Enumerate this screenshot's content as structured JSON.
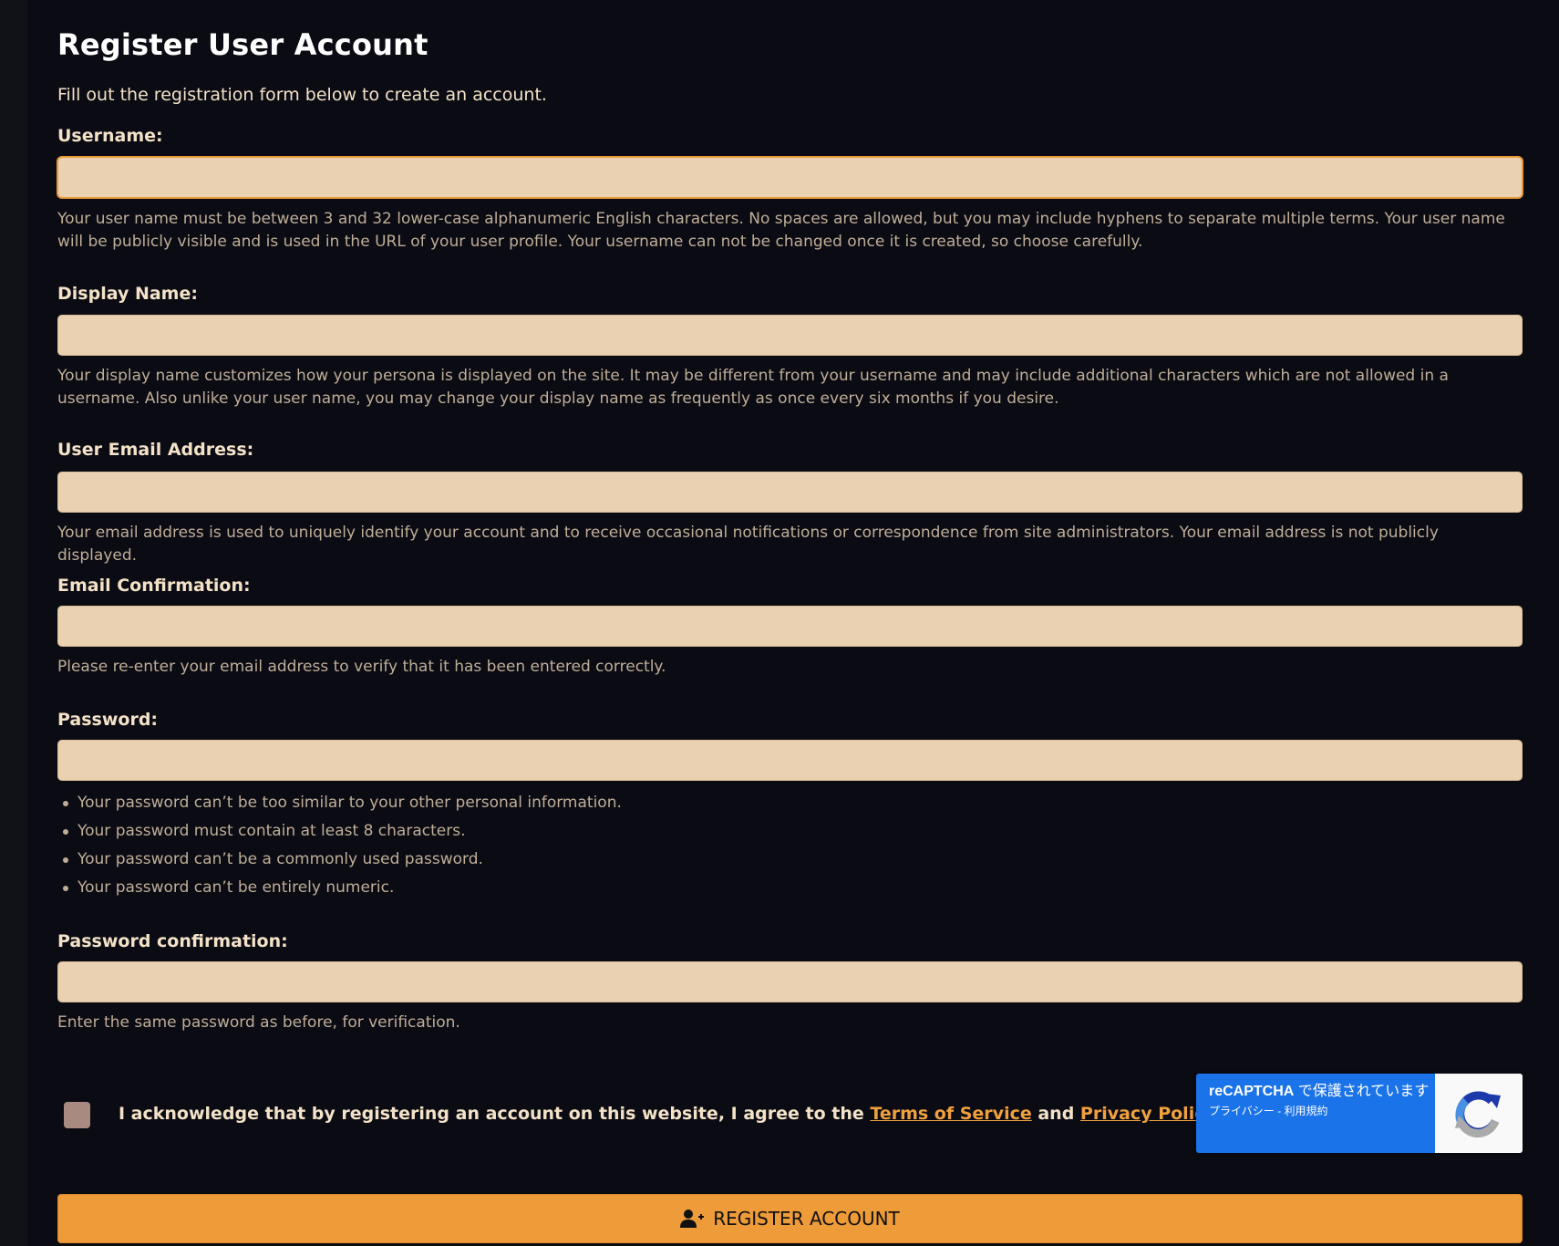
{
  "page": {
    "title": "Register User Account",
    "intro": "Fill out the registration form below to create an account."
  },
  "fields": {
    "username": {
      "label": "Username:",
      "value": "",
      "help": "Your user name must be between 3 and 32 lower-case alphanumeric English characters. No spaces are allowed, but you may include hyphens to separate multiple terms. Your user name will be publicly visible and is used in the URL of your user profile. Your username can not be changed once it is created, so choose carefully."
    },
    "display_name": {
      "label": "Display Name:",
      "value": "",
      "help": "Your display name customizes how your persona is displayed on the site. It may be different from your username and may include additional characters which are not allowed in a username. Also unlike your user name, you may change your display name as frequently as once every six months if you desire."
    },
    "email": {
      "label": "User Email Address:",
      "value": "",
      "help": "Your email address is used to uniquely identify your account and to receive occasional notifications or correspondence from site administrators. Your email address is not publicly displayed."
    },
    "email_confirm": {
      "label": "Email Confirmation:",
      "value": "",
      "help": "Please re-enter your email address to verify that it has been entered correctly."
    },
    "password": {
      "label": "Password:",
      "value": "",
      "rules": [
        "Your password can’t be too similar to your other personal information.",
        "Your password must contain at least 8 characters.",
        "Your password can’t be a commonly used password.",
        "Your password can’t be entirely numeric."
      ]
    },
    "password_confirm": {
      "label": "Password confirmation:",
      "value": "",
      "help": "Enter the same password as before, for verification."
    }
  },
  "acknowledge": {
    "prefix": "I acknowledge that by registering an account on this website, I agree to the ",
    "terms_link": "Terms of Service",
    "middle": " and ",
    "privacy_link": "Privacy Policy",
    "suffix": ".",
    "checked": false
  },
  "recaptcha": {
    "brand": "reCAPTCHA",
    "protected_text": " で保護されています",
    "privacy": "プライバシー",
    "separator": " - ",
    "terms": "利用規約"
  },
  "submit": {
    "label": "REGISTER ACCOUNT",
    "icon": "user-plus-icon"
  },
  "colors": {
    "background": "#0b0b14",
    "input_bg": "#e9d1b1",
    "accent": "#ee9b3a",
    "link": "#f0a03c",
    "recaptcha_blue": "#1a73e8"
  }
}
